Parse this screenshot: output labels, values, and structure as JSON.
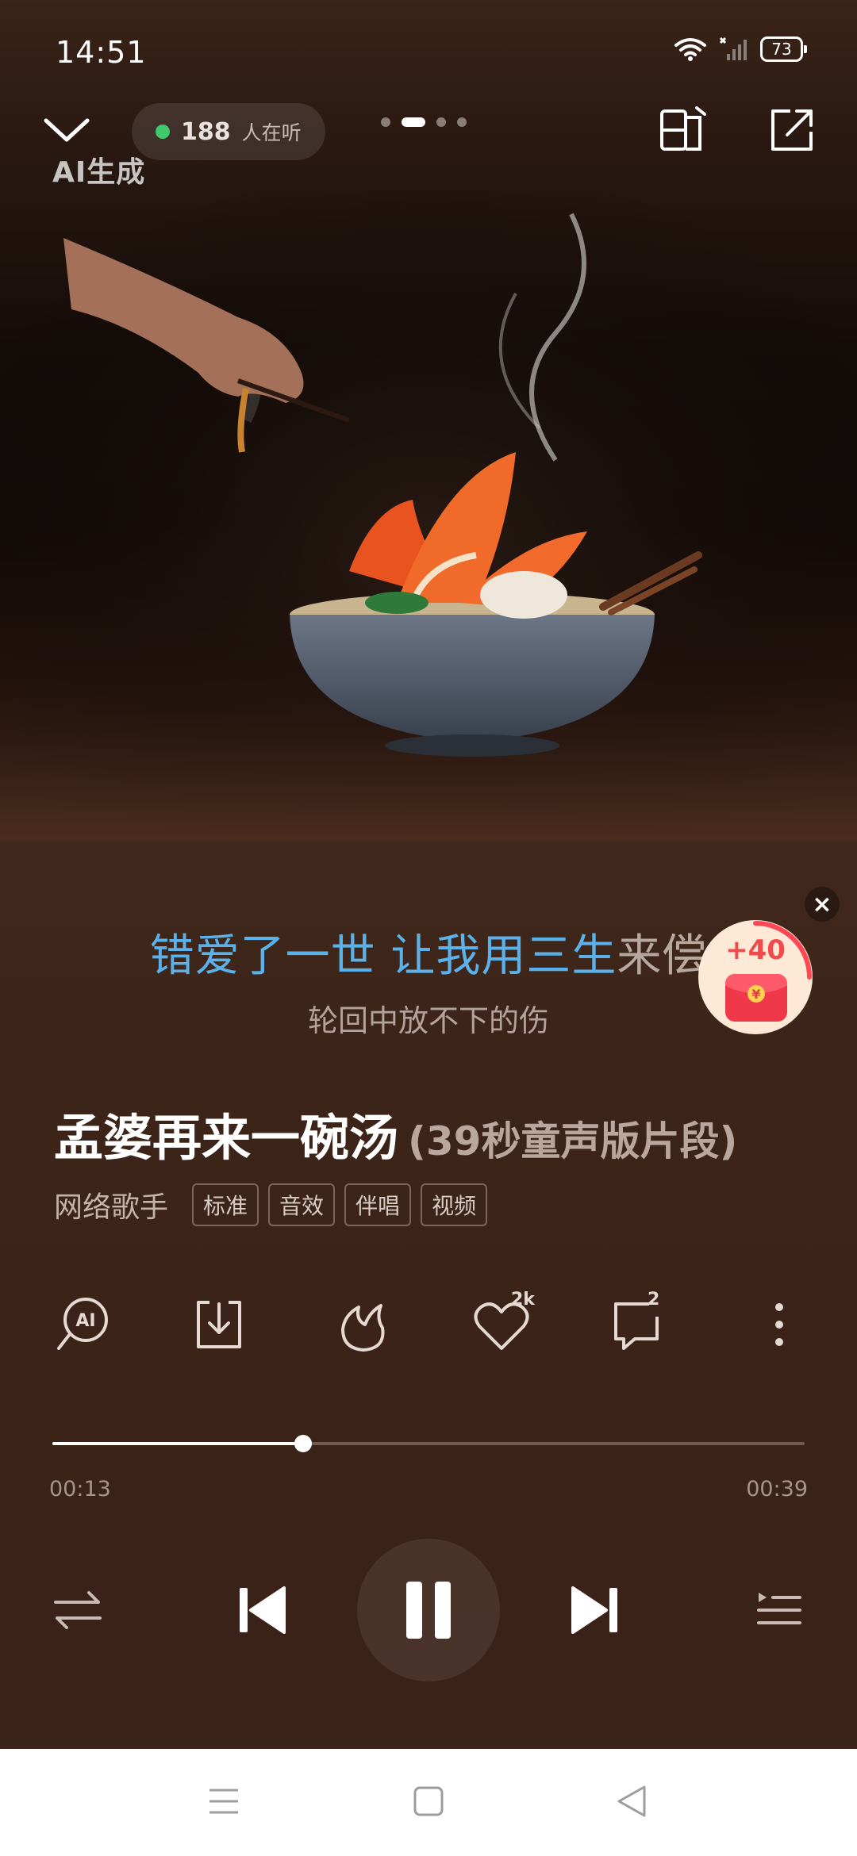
{
  "status_bar": {
    "time": "14:51",
    "battery": "73"
  },
  "header": {
    "watermark": "AI生成",
    "listeners_count": "188",
    "listeners_label": "人在听",
    "page_dots": 4,
    "active_page": 2
  },
  "lyrics": {
    "current_sung": "错爱了一世 让我用三生",
    "current_unsung": "来偿",
    "next_line": "轮回中放不下的伤"
  },
  "promo": {
    "reward": "+40",
    "coin_symbol": "¥"
  },
  "song": {
    "title": "孟婆再来一碗汤",
    "subtitle": "(39秒童声版片段)",
    "artist": "网络歌手",
    "tags": [
      "标准",
      "音效",
      "伴唱",
      "视频"
    ]
  },
  "actions": {
    "like_count": "2k",
    "comment_count": "2"
  },
  "playback": {
    "current_time": "00:13",
    "total_time": "00:39",
    "progress_fraction": 0.333,
    "state": "playing"
  },
  "colors": {
    "lyric_highlight": "#5bb2ea",
    "listener_dot": "#3fc96a",
    "background": "#3a2219"
  }
}
